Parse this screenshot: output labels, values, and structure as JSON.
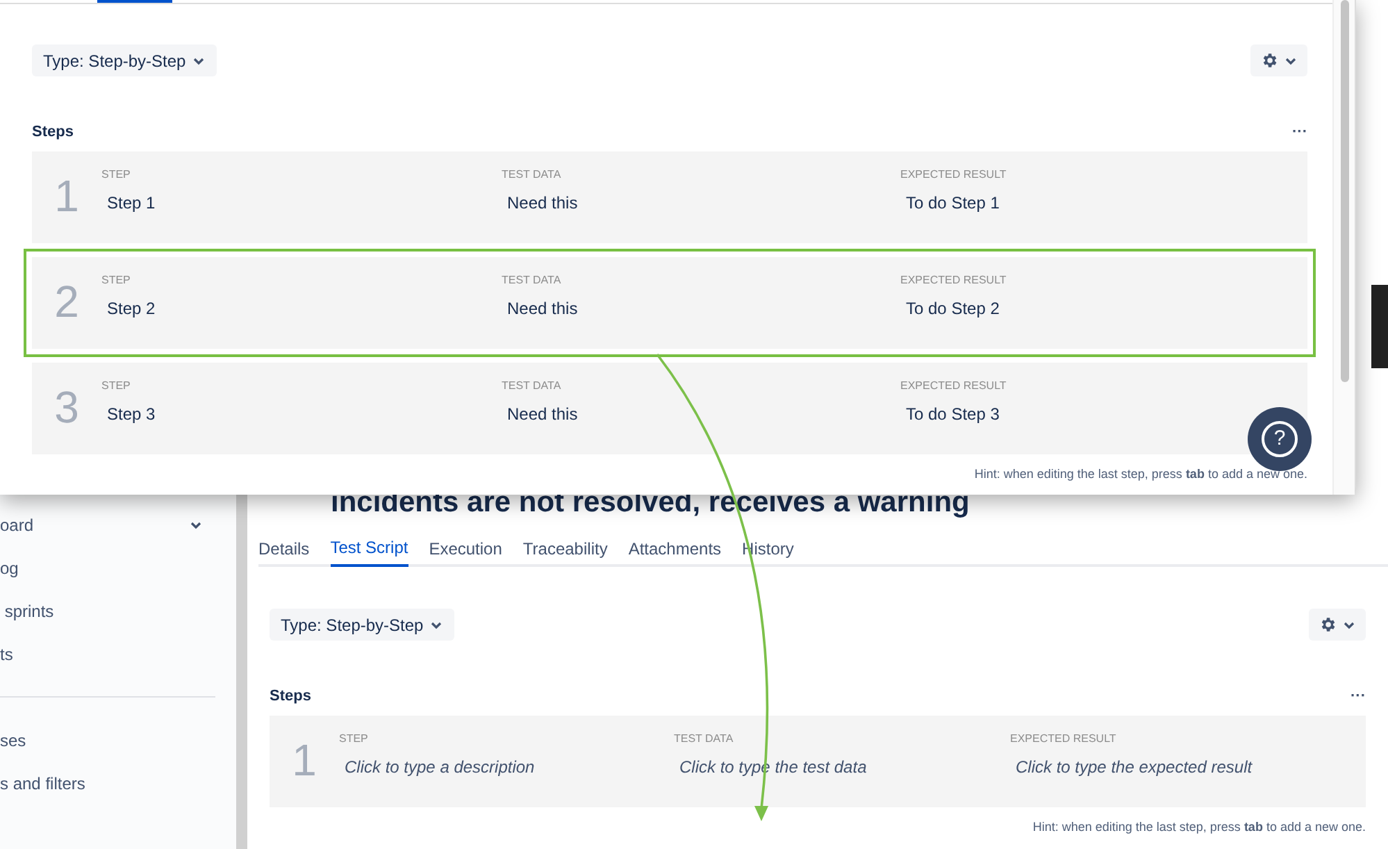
{
  "background": {
    "sidebar": {
      "items": [
        {
          "label": "oard",
          "expandable": true
        },
        {
          "label": "og",
          "expandable": false
        },
        {
          "label": " sprints",
          "expandable": false
        },
        {
          "label": "ts",
          "expandable": false
        },
        {
          "label": "ses",
          "expandable": false
        },
        {
          "label": "s and filters",
          "expandable": false
        }
      ]
    },
    "title": "incidents are not resolved, receives a warning",
    "tabs": [
      {
        "label": "Details",
        "selected": false
      },
      {
        "label": "Test Script",
        "selected": true
      },
      {
        "label": "Execution",
        "selected": false
      },
      {
        "label": "Traceability",
        "selected": false
      },
      {
        "label": "Attachments",
        "selected": false
      },
      {
        "label": "History",
        "selected": false
      }
    ],
    "type_button": "Type: Step-by-Step",
    "steps_title": "Steps",
    "more": "···",
    "steps": [
      {
        "number": "1",
        "step_label": "STEP",
        "step": "Click to type a description",
        "data_label": "TEST DATA",
        "data": "Click to type the test data",
        "result_label": "EXPECTED RESULT",
        "result": "Click to type the expected result",
        "placeholder": true,
        "highlighted": false
      }
    ],
    "hint": "Hint: when editing the last step, press **tab** to add a new one."
  },
  "overlay": {
    "type_button": "Type: Step-by-Step",
    "steps_title": "Steps",
    "more": "···",
    "steps": [
      {
        "number": "1",
        "step_label": "STEP",
        "step": "Step 1",
        "data_label": "TEST DATA",
        "data": "Need this",
        "result_label": "EXPECTED RESULT",
        "result": "To do Step 1",
        "placeholder": false,
        "highlighted": false
      },
      {
        "number": "2",
        "step_label": "STEP",
        "step": "Step 2",
        "data_label": "TEST DATA",
        "data": "Need this",
        "result_label": "EXPECTED RESULT",
        "result": "To do Step 2",
        "placeholder": false,
        "highlighted": true
      },
      {
        "number": "3",
        "step_label": "STEP",
        "step": "Step 3",
        "data_label": "TEST DATA",
        "data": "Need this",
        "result_label": "EXPECTED RESULT",
        "result": "To do Step 3",
        "placeholder": false,
        "highlighted": false
      }
    ],
    "hint": "Hint: when editing the last step, press **tab** to add a new one.",
    "help": "?"
  }
}
